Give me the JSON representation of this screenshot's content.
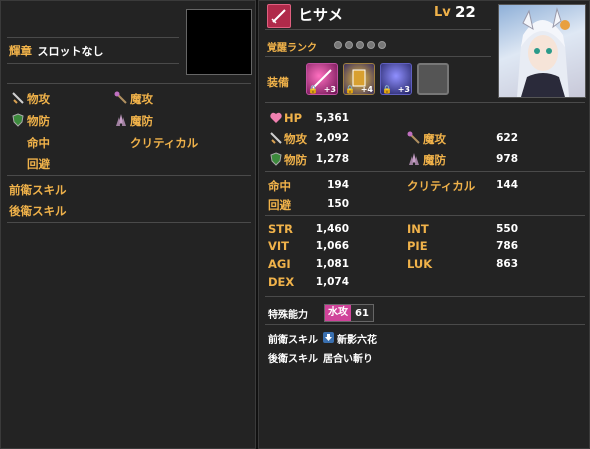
{
  "left": {
    "emblem_label": "輝章",
    "emblem_value": "スロットなし",
    "stats": {
      "phys_atk": "物攻",
      "mag_atk": "魔攻",
      "phys_def": "物防",
      "mag_def": "魔防",
      "hit": "命中",
      "crit": "クリティカル",
      "evasion": "回避"
    },
    "front_skill_label": "前衛スキル",
    "back_skill_label": "後衛スキル"
  },
  "right": {
    "name": "ヒサメ",
    "lv_label": "Lv",
    "lv_value": "22",
    "awaken_label": "覚醒ランク",
    "awaken_pips": 5,
    "equip_label": "装備",
    "equip": [
      {
        "plus": "+3"
      },
      {
        "plus": "+4"
      },
      {
        "plus": "+3"
      }
    ],
    "hp_label": "HP",
    "hp": "5,361",
    "phys_atk_label": "物攻",
    "phys_atk": "2,092",
    "mag_atk_label": "魔攻",
    "mag_atk": "622",
    "phys_def_label": "物防",
    "phys_def": "1,278",
    "mag_def_label": "魔防",
    "mag_def": "978",
    "hit_label": "命中",
    "hit": "194",
    "crit_label": "クリティカル",
    "crit": "144",
    "evasion_label": "回避",
    "evasion": "150",
    "str_label": "STR",
    "str": "1,460",
    "int_label": "INT",
    "int": "550",
    "vit_label": "VIT",
    "vit": "1,066",
    "pie_label": "PIE",
    "pie": "786",
    "agi_label": "AGI",
    "agi": "1,081",
    "luk_label": "LUK",
    "luk": "863",
    "dex_label": "DEX",
    "dex": "1,074",
    "special_label": "特殊能力",
    "special_tag": "水攻",
    "special_value": "61",
    "front_skill_label": "前衛スキル",
    "front_skill": "新影六花",
    "back_skill_label": "後衛スキル",
    "back_skill": "居合い斬り"
  },
  "colors": {
    "accent_label": "#f0b24a",
    "special_tag_bg": "#d0439a"
  }
}
